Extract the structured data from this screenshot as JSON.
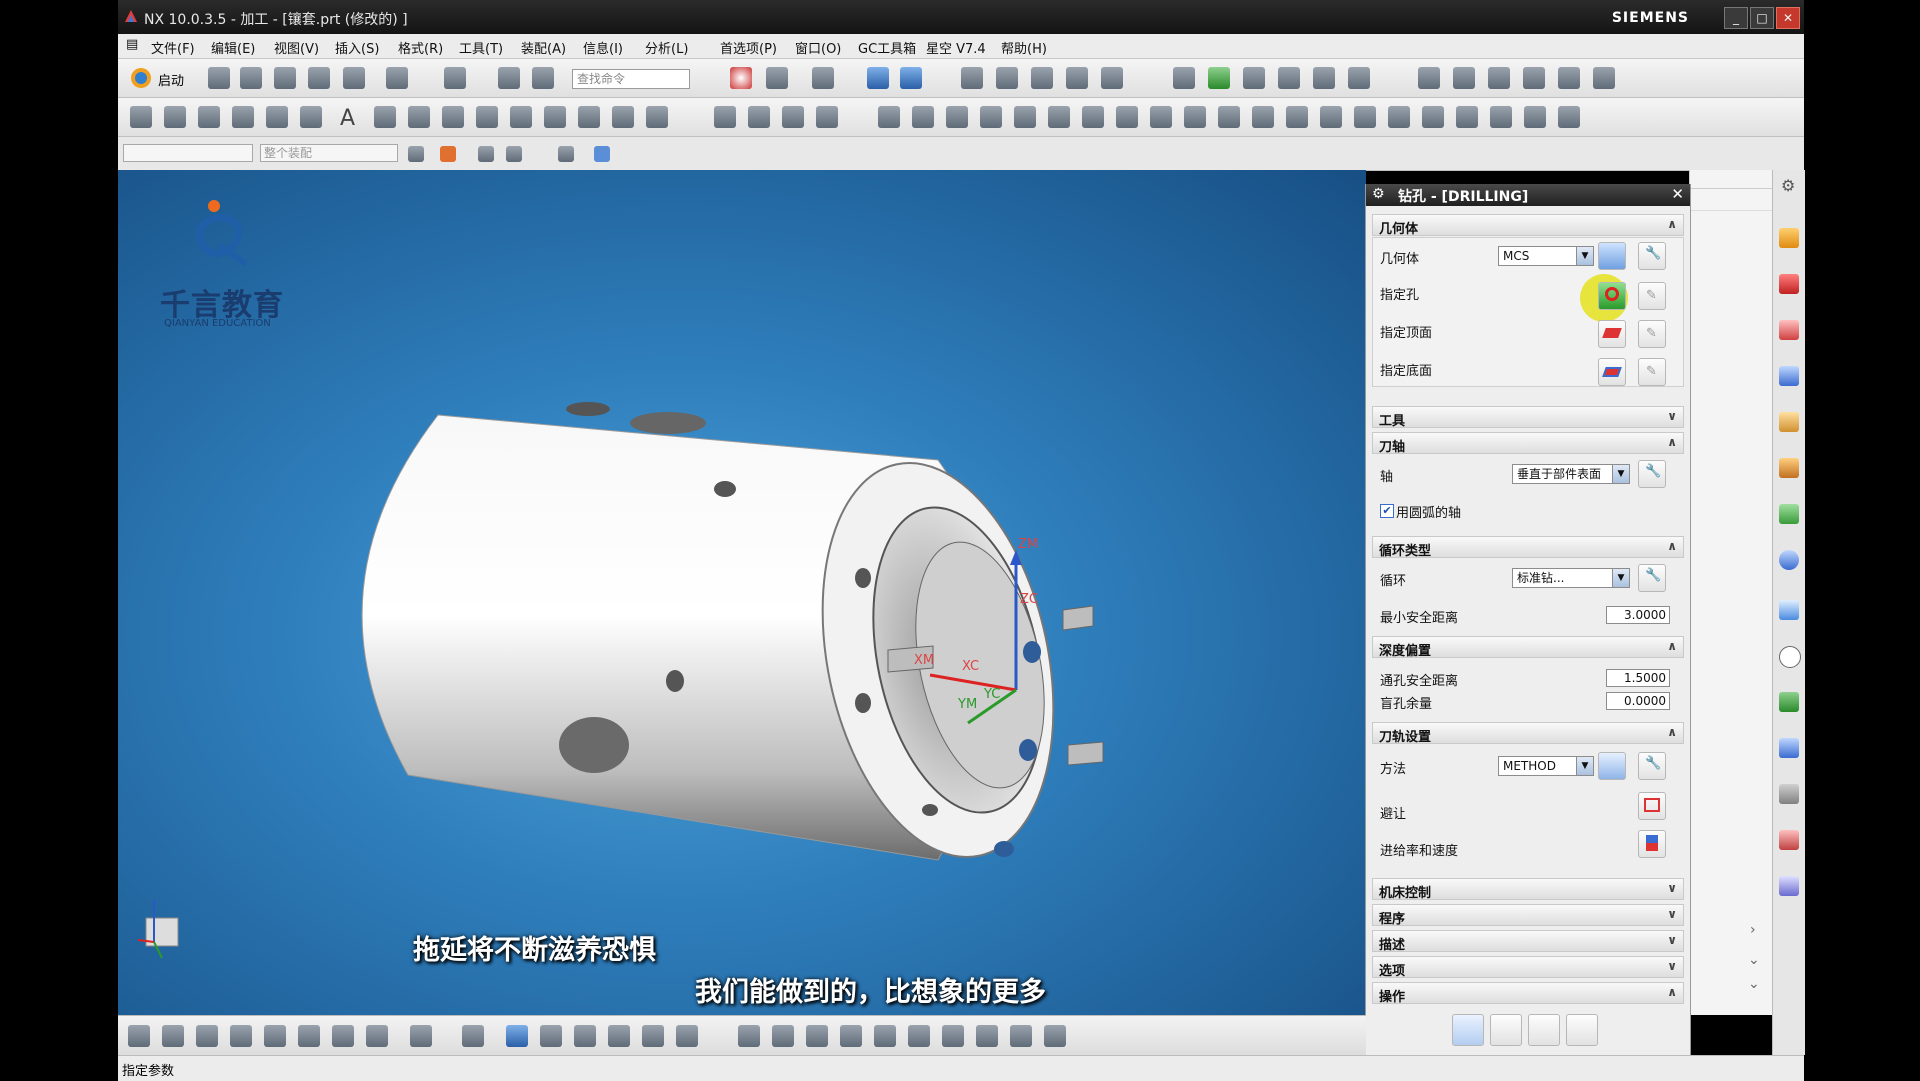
{
  "window": {
    "title": "NX 10.0.3.5 - 加工 - [镶套.prt  (修改的) ]",
    "brand": "SIEMENS",
    "controls": [
      "_",
      "□",
      "✕"
    ]
  },
  "menu": [
    "文件(F)",
    "编辑(E)",
    "视图(V)",
    "插入(S)",
    "格式(R)",
    "工具(T)",
    "装配(A)",
    "信息(I)",
    "分析(L)",
    "首选项(P)",
    "窗口(O)",
    "GC工具箱",
    "星空 V7.4",
    "帮助(H)"
  ],
  "toolbar": {
    "start_label": "启动",
    "search_placeholder": "查找命令",
    "assembly_combo": "整个装配"
  },
  "viewport": {
    "logo_cn": "千言教育",
    "logo_en": "QIANYAN EDUCATION",
    "axes": {
      "zm": "ZM",
      "zc": "ZC",
      "xm": "XM",
      "xc": "XC",
      "ym": "YM",
      "yc": "YC"
    },
    "subtitle_1": "拖延将不断滋养恐惧",
    "subtitle_2": "我们能做到的，比想象的更多"
  },
  "status": {
    "text": "指定参数"
  },
  "dialog": {
    "title": "钻孔 - [DRILLING]",
    "sections": {
      "geometry": {
        "header": "几何体",
        "geometry_label": "几何体",
        "geometry_value": "MCS",
        "specify_holes": "指定孔",
        "specify_top": "指定顶面",
        "specify_bottom": "指定底面"
      },
      "tool": {
        "header": "工具"
      },
      "tool_axis": {
        "header": "刀轴",
        "axis_label": "轴",
        "axis_value": "垂直于部件表面",
        "use_arc_axis": "用圆弧的轴",
        "use_arc_axis_checked": true
      },
      "cycle_type": {
        "header": "循环类型",
        "cycle_label": "循环",
        "cycle_value": "标准钻...",
        "min_clearance_label": "最小安全距离",
        "min_clearance_value": "3.0000"
      },
      "depth_offset": {
        "header": "深度偏置",
        "through_clearance_label": "通孔安全距离",
        "through_clearance_value": "1.5000",
        "blind_stock_label": "盲孔余量",
        "blind_stock_value": "0.0000"
      },
      "path_settings": {
        "header": "刀轨设置",
        "method_label": "方法",
        "method_value": "METHOD",
        "avoid_label": "避让",
        "feeds_label": "进给率和速度"
      },
      "machine_control": {
        "header": "机床控制"
      },
      "program": {
        "header": "程序"
      },
      "description": {
        "header": "描述"
      },
      "options": {
        "header": "选项"
      },
      "actions": {
        "header": "操作"
      }
    }
  },
  "colors": {
    "viewport_center": "#4fa4d8",
    "viewport_edge": "#174f84",
    "highlight": "#e5e21e",
    "dialog_bg": "#eeeeee"
  }
}
